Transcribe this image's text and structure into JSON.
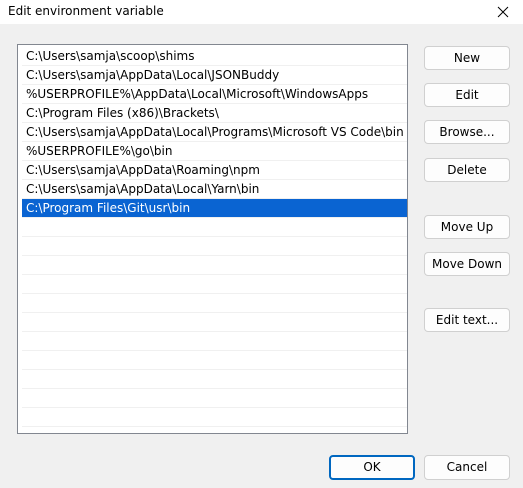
{
  "window": {
    "title": "Edit environment variable"
  },
  "list": {
    "items": [
      "C:\\Users\\samja\\scoop\\shims",
      "C:\\Users\\samja\\AppData\\Local\\JSONBuddy",
      "%USERPROFILE%\\AppData\\Local\\Microsoft\\WindowsApps",
      "C:\\Program Files (x86)\\Brackets\\",
      "C:\\Users\\samja\\AppData\\Local\\Programs\\Microsoft VS Code\\bin",
      "%USERPROFILE%\\go\\bin",
      "C:\\Users\\samja\\AppData\\Roaming\\npm",
      "C:\\Users\\samja\\AppData\\Local\\Yarn\\bin",
      "C:\\Program Files\\Git\\usr\\bin"
    ],
    "selected_index": 8
  },
  "buttons": {
    "new": "New",
    "edit": "Edit",
    "browse": "Browse...",
    "delete": "Delete",
    "move_up": "Move Up",
    "move_down": "Move Down",
    "edit_text": "Edit text...",
    "ok": "OK",
    "cancel": "Cancel"
  },
  "icons": {
    "close": "close-icon"
  },
  "colors": {
    "selection": "#0a64d2",
    "ok_border": "#0067c0"
  }
}
